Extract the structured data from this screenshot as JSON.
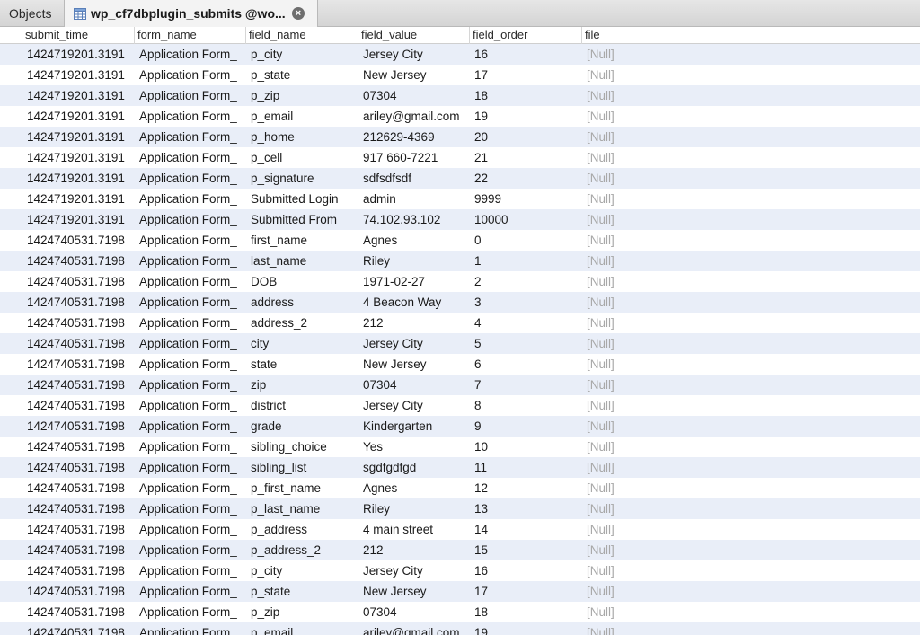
{
  "tabs": {
    "objects_label": "Objects",
    "active_label": "wp_cf7dbplugin_submits @wo...",
    "close_glyph": "×"
  },
  "columns": [
    "submit_time",
    "form_name",
    "field_name",
    "field_value",
    "field_order",
    "file"
  ],
  "rows": [
    [
      "1424719201.3191",
      "Application Form_",
      "p_city",
      "Jersey City",
      "16",
      "[Null]"
    ],
    [
      "1424719201.3191",
      "Application Form_",
      "p_state",
      "New Jersey",
      "17",
      "[Null]"
    ],
    [
      "1424719201.3191",
      "Application Form_",
      "p_zip",
      "07304",
      "18",
      "[Null]"
    ],
    [
      "1424719201.3191",
      "Application Form_",
      "p_email",
      "ariley@gmail.com",
      "19",
      "[Null]"
    ],
    [
      "1424719201.3191",
      "Application Form_",
      "p_home",
      "212629-4369",
      "20",
      "[Null]"
    ],
    [
      "1424719201.3191",
      "Application Form_",
      "p_cell",
      "917 660-7221",
      "21",
      "[Null]"
    ],
    [
      "1424719201.3191",
      "Application Form_",
      "p_signature",
      "sdfsdfsdf",
      "22",
      "[Null]"
    ],
    [
      "1424719201.3191",
      "Application Form_",
      "Submitted Login",
      "admin",
      "9999",
      "[Null]"
    ],
    [
      "1424719201.3191",
      "Application Form_",
      "Submitted From",
      "74.102.93.102",
      "10000",
      "[Null]"
    ],
    [
      "1424740531.7198",
      "Application Form_",
      "first_name",
      "Agnes",
      "0",
      "[Null]"
    ],
    [
      "1424740531.7198",
      "Application Form_",
      "last_name",
      "Riley",
      "1",
      "[Null]"
    ],
    [
      "1424740531.7198",
      "Application Form_",
      "DOB",
      "1971-02-27",
      "2",
      "[Null]"
    ],
    [
      "1424740531.7198",
      "Application Form_",
      "address",
      "4 Beacon Way",
      "3",
      "[Null]"
    ],
    [
      "1424740531.7198",
      "Application Form_",
      "address_2",
      "212",
      "4",
      "[Null]"
    ],
    [
      "1424740531.7198",
      "Application Form_",
      "city",
      "Jersey City",
      "5",
      "[Null]"
    ],
    [
      "1424740531.7198",
      "Application Form_",
      "state",
      "New Jersey",
      "6",
      "[Null]"
    ],
    [
      "1424740531.7198",
      "Application Form_",
      "zip",
      "07304",
      "7",
      "[Null]"
    ],
    [
      "1424740531.7198",
      "Application Form_",
      "district",
      "Jersey City",
      "8",
      "[Null]"
    ],
    [
      "1424740531.7198",
      "Application Form_",
      "grade",
      "Kindergarten",
      "9",
      "[Null]"
    ],
    [
      "1424740531.7198",
      "Application Form_",
      "sibling_choice",
      "Yes",
      "10",
      "[Null]"
    ],
    [
      "1424740531.7198",
      "Application Form_",
      "sibling_list",
      "sgdfgdfgd",
      "11",
      "[Null]"
    ],
    [
      "1424740531.7198",
      "Application Form_",
      "p_first_name",
      "Agnes",
      "12",
      "[Null]"
    ],
    [
      "1424740531.7198",
      "Application Form_",
      "p_last_name",
      "Riley",
      "13",
      "[Null]"
    ],
    [
      "1424740531.7198",
      "Application Form_",
      "p_address",
      "4 main street",
      "14",
      "[Null]"
    ],
    [
      "1424740531.7198",
      "Application Form_",
      "p_address_2",
      "212",
      "15",
      "[Null]"
    ],
    [
      "1424740531.7198",
      "Application Form_",
      "p_city",
      "Jersey City",
      "16",
      "[Null]"
    ],
    [
      "1424740531.7198",
      "Application Form_",
      "p_state",
      "New Jersey",
      "17",
      "[Null]"
    ],
    [
      "1424740531.7198",
      "Application Form_",
      "p_zip",
      "07304",
      "18",
      "[Null]"
    ],
    [
      "1424740531.7198",
      "Application Form_",
      "p_email",
      "ariley@gmail.com",
      "19",
      "[Null]"
    ]
  ],
  "colors": {
    "row_stripe": "#e9eef8",
    "null_text": "#a8a8a8",
    "tab_bar": "#dcdcdc"
  },
  "icons": {
    "table_icon": "table-icon",
    "close_icon": "close-icon"
  }
}
